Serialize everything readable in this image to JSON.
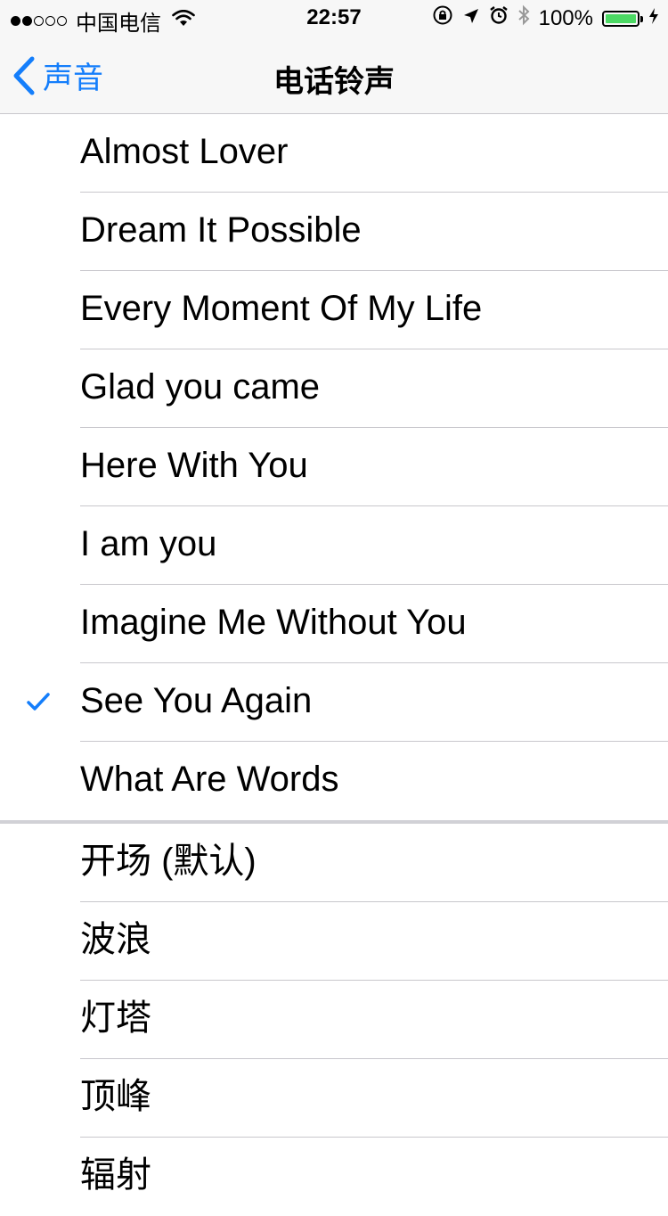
{
  "status_bar": {
    "carrier": "中国电信",
    "time": "22:57",
    "battery": "100%",
    "battery_level": 1.0,
    "icons": [
      "signal-icon",
      "wifi-icon",
      "orientation-lock-icon",
      "location-icon",
      "alarm-icon",
      "bluetooth-icon",
      "battery-icon",
      "charging-icon"
    ]
  },
  "nav": {
    "back_label": "声音",
    "title": "电话铃声"
  },
  "accent_color": "#147efb",
  "ringtones": [
    {
      "label": "Almost Lover",
      "selected": false
    },
    {
      "label": "Dream It Possible",
      "selected": false
    },
    {
      "label": "Every Moment Of My Life",
      "selected": false
    },
    {
      "label": "Glad you came",
      "selected": false
    },
    {
      "label": "Here With You",
      "selected": false
    },
    {
      "label": "I am you",
      "selected": false
    },
    {
      "label": "Imagine Me Without You",
      "selected": false
    },
    {
      "label": "See You Again",
      "selected": true
    },
    {
      "label": "What Are Words",
      "selected": false
    }
  ],
  "builtin_ringtones": [
    {
      "label": "开场 (默认)"
    },
    {
      "label": "波浪"
    },
    {
      "label": "灯塔"
    },
    {
      "label": "顶峰"
    },
    {
      "label": "辐射"
    }
  ]
}
